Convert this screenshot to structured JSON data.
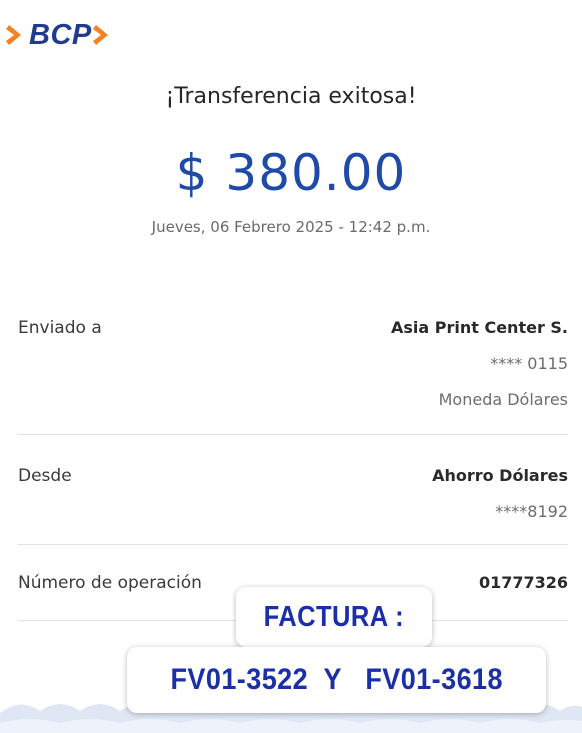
{
  "brand": {
    "logo_text": "BCP",
    "accent_color": "#f58220",
    "brand_color": "#1f3c8f"
  },
  "header": {
    "title": "¡Transferencia exitosa!",
    "amount": "$ 380.00",
    "date": "Jueves, 06 Febrero 2025 - 12:42 p.m."
  },
  "details": {
    "sent_to": {
      "label": "Enviado a",
      "name": "Asia Print Center S.",
      "account": "**** 0115",
      "currency": "Moneda Dólares"
    },
    "from": {
      "label": "Desde",
      "account_name": "Ahorro Dólares",
      "account_number": "****8192"
    },
    "operation": {
      "label": "Número de operación",
      "number": "01777326"
    }
  },
  "overlay": {
    "factura_label": "FACTURA :",
    "invoices": "FV01-3522  Y   FV01-3618",
    "text_color": "#1b2fa8"
  }
}
